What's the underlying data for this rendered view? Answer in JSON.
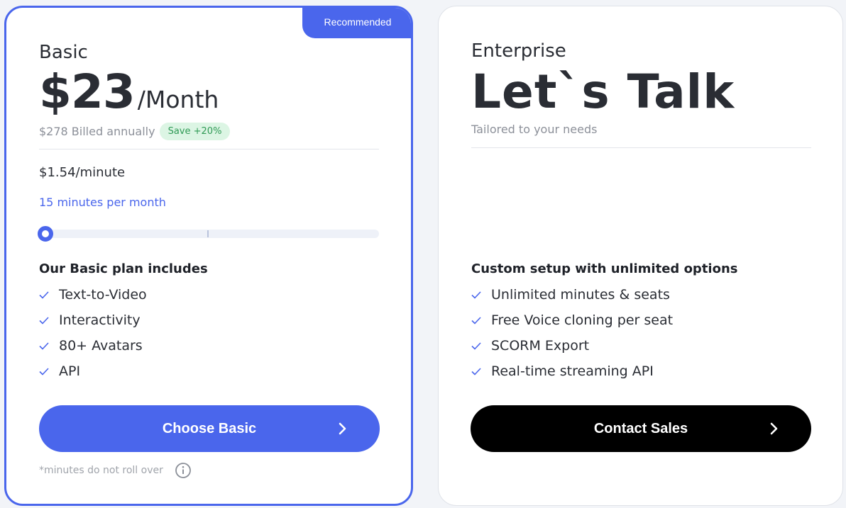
{
  "basic": {
    "ribbon": "Recommended",
    "name": "Basic",
    "price": "$23",
    "unit": "/Month",
    "billed": "$278 Billed annually",
    "save_badge": "Save +20%",
    "per_minute": "$1.54/minute",
    "minutes_label": "15 minutes per month",
    "slider_value_fraction": 0.0,
    "includes_title": "Our Basic plan includes",
    "features": [
      "Text-to-Video",
      "Interactivity",
      "80+ Avatars",
      "API"
    ],
    "cta": "Choose Basic",
    "footnote": "*minutes do not roll over",
    "icons": {
      "check": "check-icon",
      "arrow": "chevron-right-icon",
      "info": "info-icon"
    }
  },
  "enterprise": {
    "name": "Enterprise",
    "headline": "Let`s Talk",
    "subtitle": "Tailored to your needs",
    "includes_title": "Custom setup with unlimited options",
    "features": [
      "Unlimited minutes & seats",
      "Free Voice cloning per seat",
      "SCORM Export",
      "Real-time streaming API"
    ],
    "cta": "Contact Sales"
  },
  "colors": {
    "accent": "#4a66ec",
    "save_bg": "#dcf5e4",
    "save_text": "#2f9a55",
    "enterprise_cta": "#000000"
  }
}
